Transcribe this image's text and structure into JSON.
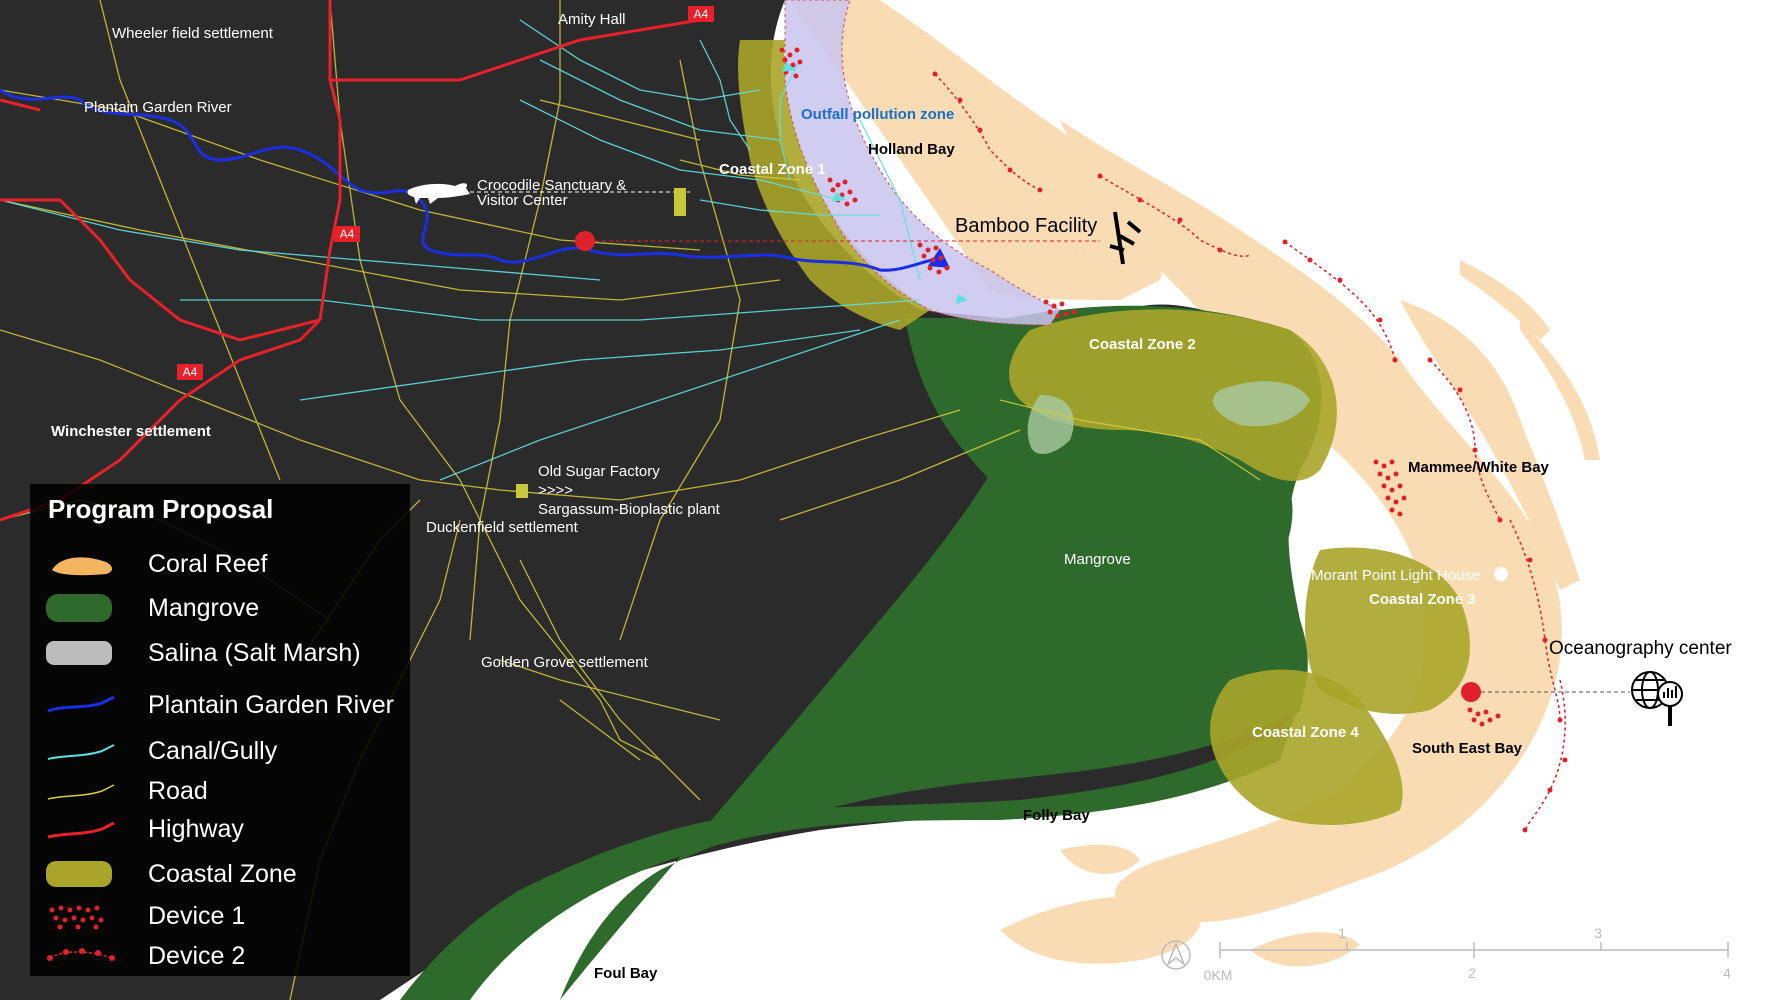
{
  "colors": {
    "land": "#2b2b2b",
    "sea": "#ffffff",
    "coral_reef": "#f9dcb4",
    "mangrove": "#2e6a2c",
    "coastal_zone": "#a8a52a",
    "salina": "#bcbcbc",
    "river": "#1a2ee6",
    "canal": "#5fe0e0",
    "road": "#d6cf3a",
    "highway": "#e8202a",
    "device": "#e0202a",
    "pollution_zone": "#c8c4ee"
  },
  "legend": {
    "title": "Program Proposal",
    "items": [
      {
        "label": "Coral Reef",
        "icon": "coral-reef-swatch"
      },
      {
        "label": "Mangrove",
        "icon": "mangrove-swatch"
      },
      {
        "label": "Salina (Salt Marsh)",
        "icon": "salina-swatch"
      },
      {
        "label": "Plantain Garden River",
        "icon": "river-line"
      },
      {
        "label": "Canal/Gully",
        "icon": "canal-line"
      },
      {
        "label": "Road",
        "icon": "road-line"
      },
      {
        "label": "Highway",
        "icon": "highway-line"
      },
      {
        "label": "Coastal Zone",
        "icon": "coastal-zone-swatch"
      },
      {
        "label": "Device 1",
        "icon": "device1-dots"
      },
      {
        "label": "Device 2",
        "icon": "device2-chain"
      }
    ]
  },
  "labels": {
    "wheeler": "Wheeler field settlement",
    "amity": "Amity Hall",
    "plantain_river": "Plantain Garden River",
    "croc1": "Crocodile Sanctuary &",
    "croc2": "Visitor Center",
    "outfall": "Outfall pollution zone",
    "holland": "Holland Bay",
    "cz1": "Coastal Zone 1",
    "bamboo": "Bamboo Facility",
    "cz2": "Coastal Zone 2",
    "winchester": "Winchester settlement",
    "sugar": "Old Sugar Factory",
    "arrows": ">>>>",
    "sargassum": "Sargassum-Bioplastic plant",
    "duckenfield": "Duckenfield settlement",
    "mangrove": "Mangrove",
    "mammee": "Mammee/White Bay",
    "morant": "Morant Point Light House",
    "cz3": "Coastal Zone 3",
    "ocean": "Oceanography center",
    "golden": "Golden Grove settlement",
    "cz4": "Coastal Zone 4",
    "southeast": "South East Bay",
    "folly": "Folly Bay",
    "foul": "Foul Bay",
    "hw_a4_1": "A4",
    "hw_a4_2": "A4",
    "hw_a4_3": "A4"
  },
  "scale_bar": {
    "labels_bottom": [
      "0KM",
      "2",
      "4"
    ],
    "labels_top": [
      "1",
      "3"
    ]
  }
}
